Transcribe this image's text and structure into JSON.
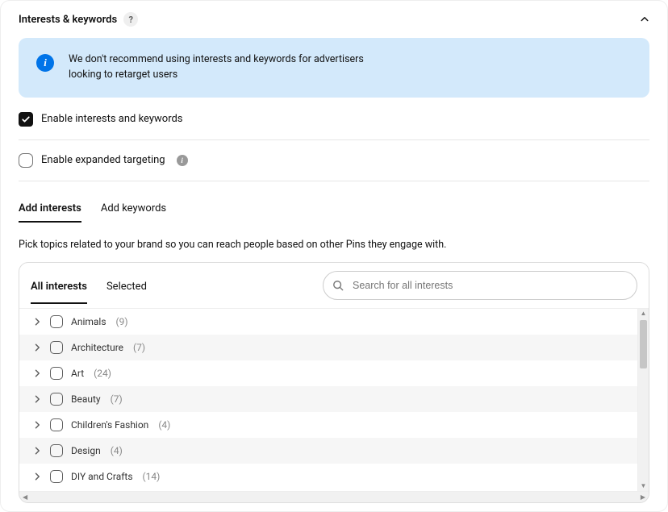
{
  "section": {
    "title": "Interests & keywords"
  },
  "banner": {
    "text": "We don't recommend using interests and keywords for advertisers looking to retarget users"
  },
  "toggles": {
    "enable_label": "Enable interests and keywords",
    "expanded_label": "Enable expanded targeting"
  },
  "main_tabs": {
    "add_interests": "Add interests",
    "add_keywords": "Add keywords"
  },
  "helper_text": "Pick topics related to your brand so you can reach people based on other Pins they engage with.",
  "inner_tabs": {
    "all": "All interests",
    "selected": "Selected"
  },
  "search": {
    "placeholder": "Search for all interests"
  },
  "interests": [
    {
      "label": "Animals",
      "count": "(9)"
    },
    {
      "label": "Architecture",
      "count": "(7)"
    },
    {
      "label": "Art",
      "count": "(24)"
    },
    {
      "label": "Beauty",
      "count": "(7)"
    },
    {
      "label": "Children's Fashion",
      "count": "(4)"
    },
    {
      "label": "Design",
      "count": "(4)"
    },
    {
      "label": "DIY and Crafts",
      "count": "(14)"
    }
  ]
}
